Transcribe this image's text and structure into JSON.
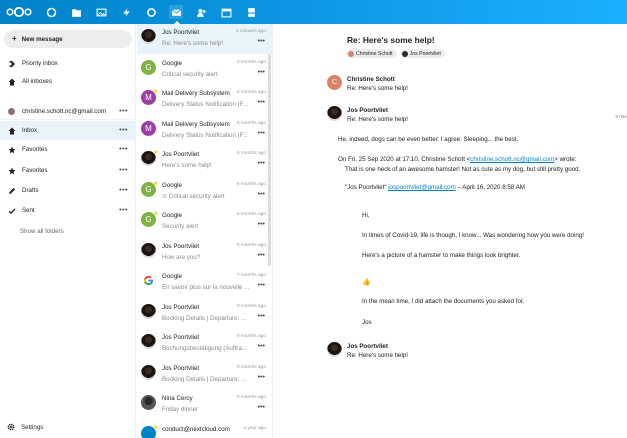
{
  "colors": {
    "topbar_start": "#0082c9",
    "topbar_end": "#1cafff",
    "selected": "#e8f4fa",
    "link": "#0082c9"
  },
  "topbar": {
    "apps": [
      "dashboard-icon",
      "files-icon",
      "photos-icon",
      "activity-icon",
      "search-icon",
      "mail-icon",
      "contacts-icon",
      "calendar-icon",
      "deck-icon"
    ],
    "active_app": "mail-icon"
  },
  "nav": {
    "new_message": "New message",
    "items": [
      {
        "label": "Priority inbox",
        "icon": "priority-icon"
      },
      {
        "label": "All inboxes",
        "icon": "inbox-icon"
      },
      {
        "label": "christine.schott.nc@gmail.com",
        "icon": "account-color-dot"
      },
      {
        "label": "Inbox",
        "icon": "inbox-icon"
      },
      {
        "label": "Favorites",
        "icon": "star-icon"
      },
      {
        "label": "Favorites",
        "icon": "star-icon"
      },
      {
        "label": "Drafts",
        "icon": "pencil-icon"
      },
      {
        "label": "Sent",
        "icon": "check-icon"
      }
    ],
    "show_all": "Show all folders",
    "settings": "Settings",
    "more": "•••"
  },
  "messages": [
    {
      "from": "Jos Poortvliet",
      "date": "3 minutes ago",
      "subject": "Re: Here's some help!",
      "avatar": "photo",
      "selected": true
    },
    {
      "from": "Google",
      "date": "2 months ago",
      "subject": "Critical security alert",
      "avatar": "G",
      "star": false
    },
    {
      "from": "Mail Delivery Subsystem",
      "date": "5 months ago",
      "subject": "Delivery Status Notification (F...",
      "avatar": "M",
      "star": true
    },
    {
      "from": "Mail Delivery Subsystem",
      "date": "5 months ago",
      "subject": "Delivery Status Notification (F...",
      "avatar": "M"
    },
    {
      "from": "Jos Poortvliet",
      "date": "5 months ago",
      "subject": "Here's some help!",
      "avatar": "photo",
      "star": true
    },
    {
      "from": "Google",
      "date": "5 months ago",
      "subject": "Critical security alert",
      "avatar": "G",
      "star": true,
      "attachment": true
    },
    {
      "from": "Google",
      "date": "5 months ago",
      "subject": "Security alert",
      "avatar": "G",
      "star": true
    },
    {
      "from": "Jos Poortvliet",
      "date": "5 months ago",
      "subject": "How are you?",
      "avatar": "photo"
    },
    {
      "from": "Google",
      "date": "7 months ago",
      "subject": "En savoir plus sur la nouvelle ...",
      "avatar": "google"
    },
    {
      "from": "Jos Poortvliet",
      "date": "9 months ago",
      "subject": "Booking Details | Departure: ...",
      "avatar": "photo"
    },
    {
      "from": "Jos Poortvliet",
      "date": "9 months ago",
      "subject": "Buchungsbestätigung (Auftra...",
      "avatar": "photo"
    },
    {
      "from": "Jos Poortvliet",
      "date": "9 months ago",
      "subject": "Booking Details | Departure: ...",
      "avatar": "photo"
    },
    {
      "from": "Nina Cercy",
      "date": "9 months ago",
      "subject": "Friday dinner",
      "avatar": "nina"
    },
    {
      "from": "conduct@nextcloud.com",
      "date": "a year ago",
      "subject": "",
      "avatar": "conduct",
      "star": true
    }
  ],
  "detail": {
    "title": "Re: Here's some help!",
    "participants": [
      "Christine Schott",
      "Jos Poortvliet"
    ],
    "thread": [
      {
        "from": "Christine Schott",
        "subject": "Re: Here's some help!",
        "initial": "C"
      },
      {
        "from": "Jos Poortvliet",
        "subject": "Re: Here's some help!",
        "time": "3 min"
      }
    ],
    "body": {
      "line1": "He, indeed, dogs can be even better. I agree. Sleeping... the best.",
      "quote_intro_pre": "On Fri, 25 Sep 2020 at 17:10, Christine Schott <",
      "quote_intro_link": "christine.schott.nc@gmail.com",
      "quote_intro_post": "> wrote:",
      "quote_line2": "That is one heck of an awesome hamster! Not as cute as my dog, but still pretty good.",
      "inner_pre": "\"Jos Poortvliet\" ",
      "inner_link": "jospoortvliet@gmail.com",
      "inner_post": " – April 16, 2020 8:58 AM",
      "hi": "Hi,",
      "covid": "In times of Covid-19, life is though, I know... Was wondering how you were doing!",
      "picture": "Here's a picture of a hamster to make things look brighter.",
      "thumb": "👍",
      "attach": "In the mean time, I did attach the documents you asked for.",
      "sign": "Jos"
    },
    "last": {
      "from": "Jos Poortvliet",
      "subject": "Re: Here's some help!"
    }
  }
}
